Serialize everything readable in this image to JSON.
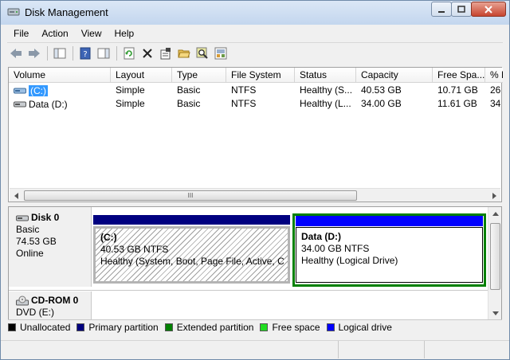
{
  "window": {
    "title": "Disk Management"
  },
  "menu": {
    "file": "File",
    "action": "Action",
    "view": "View",
    "help": "Help"
  },
  "volumes": {
    "columns": [
      "Volume",
      "Layout",
      "Type",
      "File System",
      "Status",
      "Capacity",
      "Free Spa...",
      "% F"
    ],
    "rows": [
      {
        "volume": "(C:)",
        "layout": "Simple",
        "type": "Basic",
        "fs": "NTFS",
        "status": "Healthy (S...",
        "capacity": "40.53 GB",
        "free": "10.71 GB",
        "pct": "26"
      },
      {
        "volume": "Data (D:)",
        "layout": "Simple",
        "type": "Basic",
        "fs": "NTFS",
        "status": "Healthy (L...",
        "capacity": "34.00 GB",
        "free": "11.61 GB",
        "pct": "34"
      }
    ],
    "scroll_glyph": "III"
  },
  "disks": [
    {
      "name": "Disk 0",
      "kind": "Basic",
      "size": "74.53 GB",
      "state": "Online",
      "partitions": [
        {
          "label": "(C:)",
          "size": "40.53 GB NTFS",
          "status": "Healthy (System, Boot, Page File, Active, Cra"
        },
        {
          "label": "Data  (D:)",
          "size": "34.00 GB NTFS",
          "status": "Healthy (Logical Drive)"
        }
      ]
    },
    {
      "name": "CD-ROM 0",
      "kind": "DVD (E:)"
    }
  ],
  "legend": [
    {
      "label": "Unallocated",
      "color": "#000000"
    },
    {
      "label": "Primary partition",
      "color": "#00007f"
    },
    {
      "label": "Extended partition",
      "color": "#008000"
    },
    {
      "label": "Free space",
      "color": "#21dd21"
    },
    {
      "label": "Logical drive",
      "color": "#0000ff"
    }
  ],
  "colors": {
    "primary_bar": "#000080",
    "logical_bar": "#0000ff",
    "extended_border": "#008000",
    "selection": "#3399ff"
  }
}
